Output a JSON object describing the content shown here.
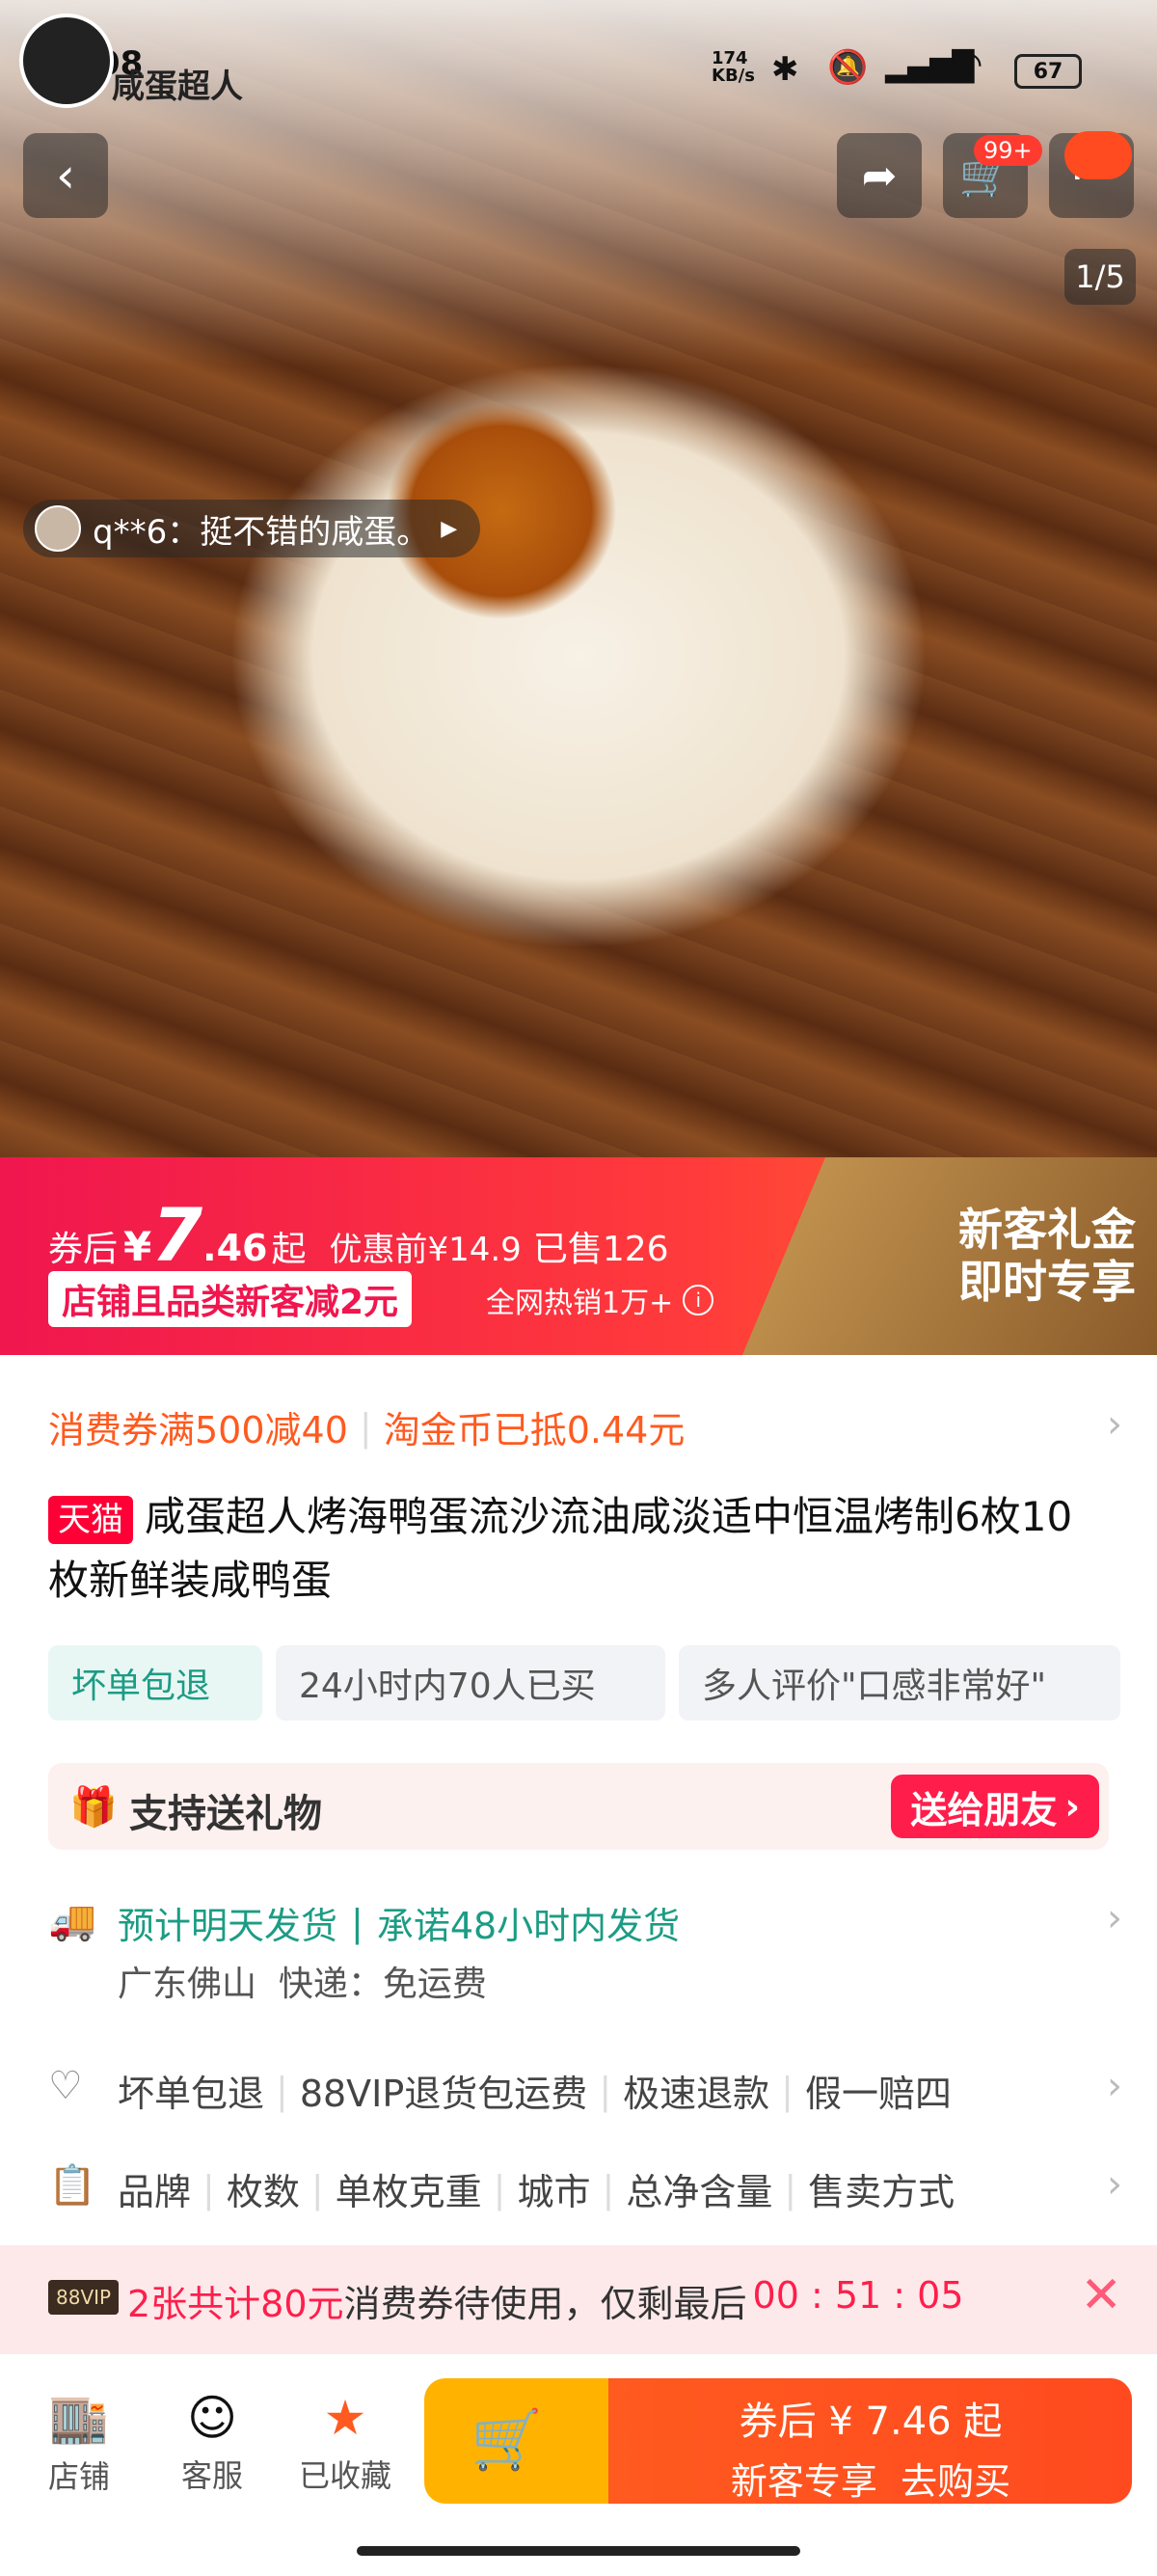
{
  "status_bar": {
    "time": "23:08",
    "net_speed": "174\nKB/s",
    "battery": "67"
  },
  "logo_text": "咸蛋超人",
  "top_actions": {
    "cart_badge": "99+"
  },
  "hero": {
    "pager": "1/5",
    "review": "q**6：挺不错的咸蛋。"
  },
  "price": {
    "prefix": "券后",
    "currency": "¥",
    "int": "7",
    "dec": ".46",
    "suffix": "起",
    "before": "优惠前¥14.9",
    "sold": "已售126",
    "promo": "店铺且品类新客减2元",
    "hot": "全网热销1万+",
    "newcomer_line1": "新客礼金",
    "newcomer_line2": "即时专享"
  },
  "coupon": {
    "left": "消费券满500减40",
    "right": "淘金币已抵0.44元"
  },
  "title": {
    "badge": "天猫",
    "text": "咸蛋超人烤海鸭蛋流沙流油咸淡适中恒温烤制6枚10枚新鲜装咸鸭蛋"
  },
  "tags": [
    "坏单包退",
    "24小时内70人已买",
    "多人评价\"口感非常好\""
  ],
  "gift": {
    "label": "支持送礼物",
    "button": "送给朋友"
  },
  "shipping": {
    "line1a": "预计明天发货",
    "line1b": "承诺48小时内发货",
    "line2": "广东佛山  快递：免运费"
  },
  "services": [
    "坏单包退",
    "88VIP退货包运费",
    "极速退款",
    "假一赔四"
  ],
  "params": [
    "品牌",
    "枚数",
    "单枚克重",
    "城市",
    "总净含量",
    "售卖方式"
  ],
  "vip_banner": {
    "badge": "88VIP",
    "highlight": "2张共计80元",
    "text": "消费券待使用，仅剩最后",
    "countdown": "00 : 51 : 05"
  },
  "bottom_bar": {
    "store": "店铺",
    "service": "客服",
    "fav": "已收藏",
    "buy_line1": "券后 ¥ 7.46 起",
    "buy_line2": "新客专享  去购买"
  }
}
